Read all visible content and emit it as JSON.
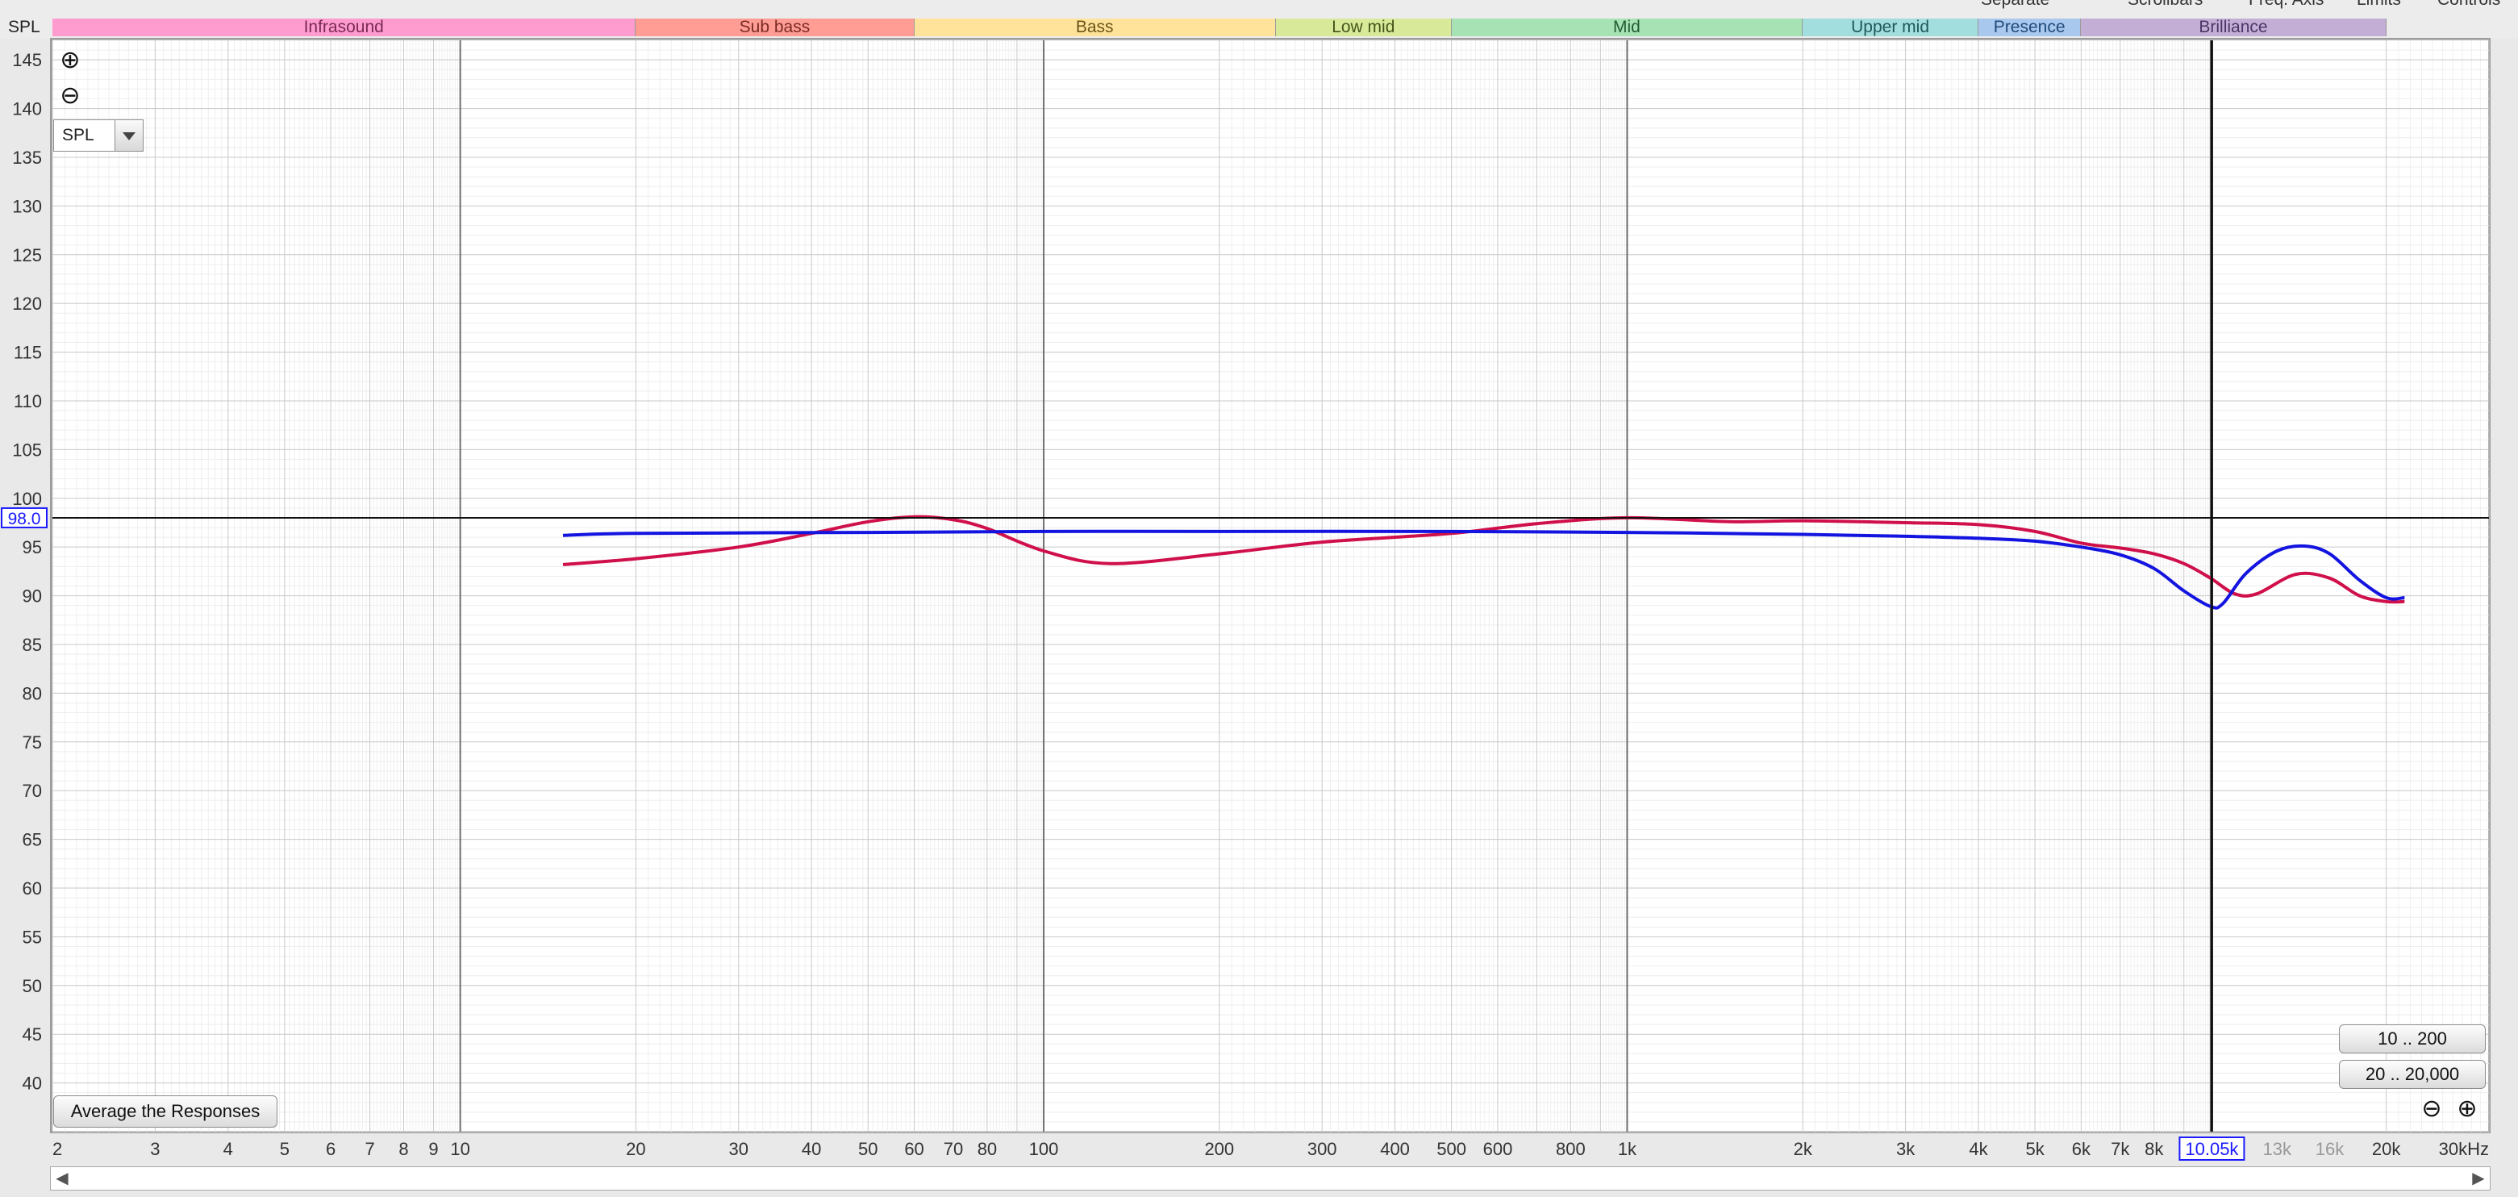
{
  "header": {
    "y_unit_label": "SPL",
    "top_links": [
      "Separate",
      "Scrollbars",
      "Freq. Axis",
      "Limits",
      "Controls"
    ]
  },
  "bands": [
    {
      "name": "Infrasound",
      "from": 2,
      "to": 20,
      "color": "#ff9ccf",
      "text_color": "#7a2a55"
    },
    {
      "name": "Sub bass",
      "from": 20,
      "to": 60,
      "color": "#ff9d95",
      "text_color": "#7a2a24"
    },
    {
      "name": "Bass",
      "from": 60,
      "to": 250,
      "color": "#ffe39a",
      "text_color": "#6a5418"
    },
    {
      "name": "Low mid",
      "from": 250,
      "to": 500,
      "color": "#d8ea9a",
      "text_color": "#46561a"
    },
    {
      "name": "Mid",
      "from": 500,
      "to": 2000,
      "color": "#a6e2b3",
      "text_color": "#245c34"
    },
    {
      "name": "Upper mid",
      "from": 2000,
      "to": 4000,
      "color": "#a3dede",
      "text_color": "#1f5858"
    },
    {
      "name": "Presence",
      "from": 4000,
      "to": 6000,
      "color": "#a8c8ee",
      "text_color": "#224a7a"
    },
    {
      "name": "Brilliance",
      "from": 6000,
      "to": 20000,
      "color": "#c3afd6",
      "text_color": "#4c3466"
    }
  ],
  "controls": {
    "spl_select_value": "SPL",
    "average_button": "Average the Responses",
    "range_btn_1": "10 .. 200",
    "range_btn_2": "20 .. 20,000",
    "zoom_in_icon": "zoom-in-icon",
    "zoom_out_icon": "zoom-out-icon"
  },
  "cursor": {
    "y_readout": "98.0",
    "x_readout": "10.05k"
  },
  "chart_data": {
    "type": "line",
    "x_scale": "log",
    "xlim": [
      2,
      30000
    ],
    "ylim": [
      35,
      147
    ],
    "x_ticks": [
      {
        "v": 2,
        "label": "2"
      },
      {
        "v": 3,
        "label": "3"
      },
      {
        "v": 4,
        "label": "4"
      },
      {
        "v": 5,
        "label": "5"
      },
      {
        "v": 6,
        "label": "6"
      },
      {
        "v": 7,
        "label": "7"
      },
      {
        "v": 8,
        "label": "8"
      },
      {
        "v": 9,
        "label": "9"
      },
      {
        "v": 10,
        "label": "10"
      },
      {
        "v": 20,
        "label": "20"
      },
      {
        "v": 30,
        "label": "30"
      },
      {
        "v": 40,
        "label": "40"
      },
      {
        "v": 50,
        "label": "50"
      },
      {
        "v": 60,
        "label": "60"
      },
      {
        "v": 70,
        "label": "70"
      },
      {
        "v": 80,
        "label": "80"
      },
      {
        "v": 100,
        "label": "100"
      },
      {
        "v": 200,
        "label": "200"
      },
      {
        "v": 300,
        "label": "300"
      },
      {
        "v": 400,
        "label": "400"
      },
      {
        "v": 500,
        "label": "500"
      },
      {
        "v": 600,
        "label": "600"
      },
      {
        "v": 800,
        "label": "800"
      },
      {
        "v": 1000,
        "label": "1k"
      },
      {
        "v": 2000,
        "label": "2k"
      },
      {
        "v": 3000,
        "label": "3k"
      },
      {
        "v": 4000,
        "label": "4k"
      },
      {
        "v": 5000,
        "label": "5k"
      },
      {
        "v": 6000,
        "label": "6k"
      },
      {
        "v": 7000,
        "label": "7k"
      },
      {
        "v": 8000,
        "label": "8k"
      },
      {
        "v": 13000,
        "label": "13k"
      },
      {
        "v": 16000,
        "label": "16k"
      },
      {
        "v": 20000,
        "label": "20k"
      },
      {
        "v": 30000,
        "label": "30kHz"
      }
    ],
    "y_ticks": [
      40,
      45,
      50,
      55,
      60,
      65,
      70,
      75,
      80,
      85,
      90,
      95,
      100,
      105,
      110,
      115,
      120,
      125,
      130,
      135,
      140,
      145
    ],
    "cursor_x": 10050,
    "cursor_y": 98.0,
    "series": [
      {
        "color": "#d0104a",
        "x": [
          15,
          20,
          30,
          40,
          50,
          60,
          70,
          80,
          100,
          130,
          200,
          300,
          500,
          700,
          1000,
          1500,
          2000,
          3000,
          4000,
          5000,
          6000,
          7000,
          8000,
          9000,
          10000,
          11000,
          12000,
          14000,
          16000,
          18000,
          20000,
          21500
        ],
        "y": [
          93.2,
          93.8,
          95.0,
          96.4,
          97.6,
          98.1,
          97.8,
          96.9,
          94.6,
          93.3,
          94.3,
          95.5,
          96.4,
          97.4,
          98.0,
          97.6,
          97.7,
          97.5,
          97.3,
          96.6,
          95.4,
          94.9,
          94.3,
          93.3,
          91.8,
          90.2,
          90.2,
          92.2,
          91.8,
          90.0,
          89.4,
          89.4
        ]
      },
      {
        "color": "#1414e0",
        "x": [
          15,
          20,
          50,
          100,
          200,
          500,
          1000,
          2000,
          3000,
          4000,
          5000,
          6000,
          7000,
          8000,
          9000,
          10000,
          10500,
          11500,
          13000,
          14500,
          16000,
          18000,
          20000,
          21500
        ],
        "y": [
          96.2,
          96.4,
          96.5,
          96.6,
          96.6,
          96.6,
          96.5,
          96.3,
          96.1,
          95.9,
          95.6,
          95.0,
          94.2,
          92.8,
          90.5,
          88.9,
          89.2,
          92.3,
          94.6,
          95.1,
          94.3,
          91.6,
          89.8,
          89.8
        ]
      }
    ]
  }
}
